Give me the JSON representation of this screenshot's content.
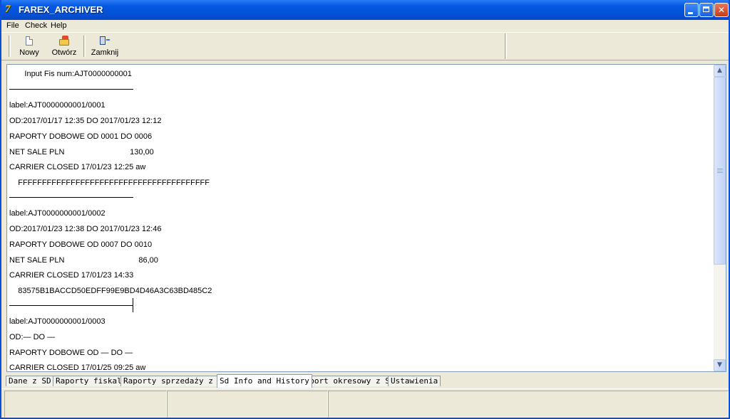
{
  "window": {
    "title": "FAREX_ARCHIVER",
    "icon": "farex-app-icon"
  },
  "menu": [
    {
      "label": "File"
    },
    {
      "label": "Check"
    },
    {
      "label": "Help"
    }
  ],
  "toolbar": {
    "new_label": "Nowy",
    "open_label": "Otwórz",
    "close_label": "Zamknij"
  },
  "content": {
    "lines": [
      "       Input Fis num:AJT0000000001",
      "label:AJT0000000001/0001",
      "OD:2017/01/17 12:35 DO 2017/01/23 12:12",
      "RAPORTY DOBOWE OD 0001 DO 0006",
      "NET SALE PLN                              130,00",
      "CARRIER CLOSED 17/01/23 12:25 aw",
      "    FFFFFFFFFFFFFFFFFFFFFFFFFFFFFFFFFFFFFFFF",
      "label:AJT0000000001/0002",
      "OD:2017/01/23 12:38 DO 2017/01/23 12:46",
      "RAPORTY DOBOWE OD 0007 DO 0010",
      "NET SALE PLN                                  86,00",
      "CARRIER CLOSED 17/01/23 14:33",
      "    83575B1BACCD50EDFF99E9BD4D46A3C63BD485C2",
      "label:AJT0000000001/0003",
      "OD:— DO —",
      "RAPORTY DOBOWE OD — DO —",
      "CARRIER CLOSED 17/01/25 09:25 aw"
    ]
  },
  "tabs": [
    {
      "label": "Dane z SD"
    },
    {
      "label": "Raporty fiskalne"
    },
    {
      "label": "Raporty sprzedaży z SD"
    },
    {
      "label": "Sd Info and History",
      "active": true
    },
    {
      "label": "Raport okresowy z SD"
    },
    {
      "label": "Ustawienia"
    }
  ],
  "statusbar": {
    "panels": [
      "",
      "",
      ""
    ]
  },
  "colors": {
    "titlebar": "#0558e2",
    "face": "#ece9d8",
    "border": "#7f9db9"
  }
}
